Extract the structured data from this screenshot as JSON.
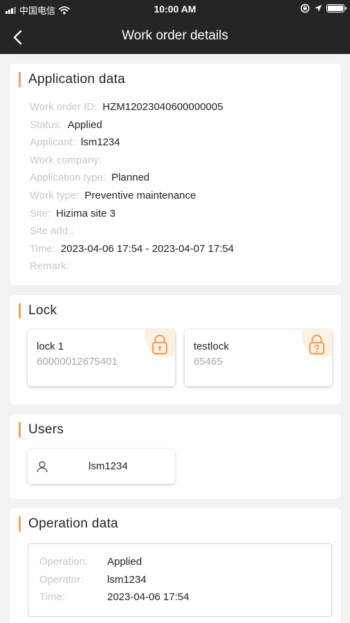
{
  "status_bar": {
    "carrier": "中国电信",
    "time": "10:00 AM"
  },
  "nav": {
    "title": "Work order details"
  },
  "application": {
    "title": "Application data",
    "fields": [
      {
        "label": "Work order ID:",
        "value": "HZM12023040600000005"
      },
      {
        "label": "Status:",
        "value": "Applied"
      },
      {
        "label": "Applicant:",
        "value": "lsm1234"
      },
      {
        "label": "Work company:",
        "value": ""
      },
      {
        "label": "Application type:",
        "value": "Planned"
      },
      {
        "label": "Work type:",
        "value": "Preventive maintenance"
      },
      {
        "label": "Site:",
        "value": "Hizima site 3"
      },
      {
        "label": "Site add.:",
        "value": ""
      },
      {
        "label": "Time:",
        "value": "2023-04-06 17:54 - 2023-04-07 17:54"
      },
      {
        "label": "Remark:",
        "value": ""
      }
    ]
  },
  "lock": {
    "title": "Lock",
    "items": [
      {
        "name": "lock 1",
        "serial": "60000012675401",
        "icon": "lock-icon"
      },
      {
        "name": "testlock",
        "serial": "65465",
        "icon": "lock-question-icon"
      }
    ]
  },
  "users": {
    "title": "Users",
    "items": [
      {
        "name": "lsm1234",
        "icon": "user-icon"
      }
    ]
  },
  "operation": {
    "title": "Operation data",
    "fields": [
      {
        "label": "Operation:",
        "value": "Applied"
      },
      {
        "label": "Operator:",
        "value": "lsm1234"
      },
      {
        "label": "Time:",
        "value": "2023-04-06 17:54"
      }
    ]
  },
  "colors": {
    "header": "#252525",
    "accent": "#f0a057",
    "background": "#f2f2f2"
  }
}
